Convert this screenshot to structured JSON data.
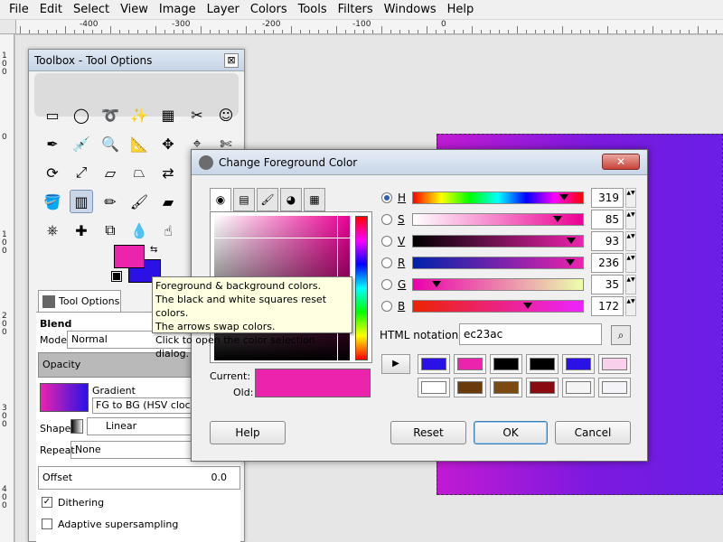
{
  "menubar": [
    "File",
    "Edit",
    "Select",
    "View",
    "Image",
    "Layer",
    "Colors",
    "Tools",
    "Filters",
    "Windows",
    "Help"
  ],
  "ruler": {
    "h_ticks": [
      "-400",
      "-300",
      "-200",
      "-100",
      "0"
    ],
    "v_ticks": [
      "100",
      "0",
      "100",
      "200",
      "300",
      "400"
    ]
  },
  "toolbox": {
    "title": "Toolbox - Tool Options",
    "close": "⊠",
    "tools": [
      {
        "name": "rect-select-icon",
        "glyph": "▭"
      },
      {
        "name": "ellipse-select-icon",
        "glyph": "◯"
      },
      {
        "name": "free-select-icon",
        "glyph": "➰"
      },
      {
        "name": "fuzzy-select-icon",
        "glyph": "✨"
      },
      {
        "name": "select-by-color-icon",
        "glyph": "▦"
      },
      {
        "name": "scissors-icon",
        "glyph": "✂"
      },
      {
        "name": "foreground-select-icon",
        "glyph": "☺"
      },
      {
        "name": "paths-icon",
        "glyph": "✒"
      },
      {
        "name": "color-picker-icon",
        "glyph": "💉"
      },
      {
        "name": "zoom-icon",
        "glyph": "🔍"
      },
      {
        "name": "measure-icon",
        "glyph": "📐"
      },
      {
        "name": "move-icon",
        "glyph": "✥"
      },
      {
        "name": "align-icon",
        "glyph": "⌖"
      },
      {
        "name": "crop-icon",
        "glyph": "✄"
      },
      {
        "name": "rotate-icon",
        "glyph": "⟳"
      },
      {
        "name": "scale-icon",
        "glyph": "⤢"
      },
      {
        "name": "shear-icon",
        "glyph": "▱"
      },
      {
        "name": "perspective-icon",
        "glyph": "⏢"
      },
      {
        "name": "flip-icon",
        "glyph": "⇄"
      },
      {
        "name": "cage-icon",
        "glyph": "⬠"
      },
      {
        "name": "text-icon",
        "glyph": "A"
      },
      {
        "name": "bucket-fill-icon",
        "glyph": "🪣"
      },
      {
        "name": "blend-icon",
        "glyph": "▥",
        "active": true
      },
      {
        "name": "pencil-icon",
        "glyph": "✏"
      },
      {
        "name": "paintbrush-icon",
        "glyph": "🖌"
      },
      {
        "name": "eraser-icon",
        "glyph": "▰"
      },
      {
        "name": "airbrush-icon",
        "glyph": "✈"
      },
      {
        "name": "ink-icon",
        "glyph": "✑"
      },
      {
        "name": "clone-icon",
        "glyph": "⎈"
      },
      {
        "name": "heal-icon",
        "glyph": "✚"
      },
      {
        "name": "perspective-clone-icon",
        "glyph": "⧉"
      },
      {
        "name": "blur-icon",
        "glyph": "💧"
      },
      {
        "name": "smudge-icon",
        "glyph": "☝"
      },
      {
        "name": "dodge-burn-icon",
        "glyph": "◐"
      }
    ],
    "tab_label": "Tool Options",
    "blend_title": "Blend",
    "mode_label": "Mode:",
    "mode_value": "Normal",
    "opacity_label": "Opacity",
    "gradient_label": "Gradient",
    "gradient_value": "FG to BG (HSV clockwi",
    "shape_label": "Shape:",
    "shape_value": "Linear",
    "repeat_label": "Repeat:",
    "repeat_value": "None",
    "offset_label": "Offset",
    "offset_value": "0.0",
    "dithering_label": "Dithering",
    "dithering_checked": true,
    "adaptive_label": "Adaptive supersampling",
    "adaptive_checked": false
  },
  "tooltip": {
    "lines": [
      "Foreground & background colors.",
      "The black and white squares reset colors.",
      "The arrows swap colors.",
      "Click to open the color selection dialog."
    ]
  },
  "dialog": {
    "title": "Change Foreground Color",
    "close": "✕",
    "current_label": "Current:",
    "old_label": "Old:",
    "current_color": "#ec23ac",
    "sliders": [
      {
        "label": "H",
        "value": "319",
        "fraction": 0.886,
        "selected": true
      },
      {
        "label": "S",
        "value": "85",
        "fraction": 0.85,
        "selected": false
      },
      {
        "label": "V",
        "value": "93",
        "fraction": 0.93,
        "selected": false
      },
      {
        "label": "R",
        "value": "236",
        "fraction": 0.925,
        "selected": false
      },
      {
        "label": "G",
        "value": "35",
        "fraction": 0.137,
        "selected": false
      },
      {
        "label": "B",
        "value": "172",
        "fraction": 0.675,
        "selected": false
      }
    ],
    "html_label": "HTML notation:",
    "html_value": "ec23ac",
    "history_row1": [
      "#2a12e6",
      "#ec23ac",
      "#000000",
      "#000000",
      "#2a12e6",
      "#f8d0ec"
    ],
    "history_row2": [
      "#ffffff",
      "#6b3a0a",
      "#7a4a12",
      "#8a0a12",
      "#f4f4f4",
      "#f4f4f8"
    ],
    "buttons": {
      "help": "Help",
      "reset": "Reset",
      "ok": "OK",
      "cancel": "Cancel"
    }
  }
}
